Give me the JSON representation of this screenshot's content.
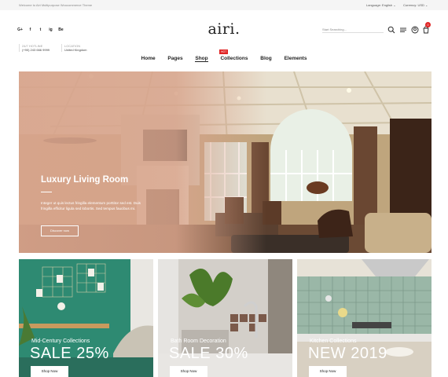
{
  "topbar": {
    "welcome": "Welcome to Airi Multipurpose Woocommerce Theme",
    "language": "Language: English",
    "currency": "Currency: USD"
  },
  "header": {
    "logo": "airi.",
    "social": [
      "G+",
      "f",
      "t",
      "ig",
      "Be"
    ],
    "search_placeholder": "Start Searching...",
    "cart_count": "0",
    "hotline_label": "24/7 HOTLINE",
    "hotline_value": "(+90) 243 666 9999",
    "location_label": "LOCATION",
    "location_value": "United Kingdom"
  },
  "nav": {
    "items": [
      "Home",
      "Pages",
      "Shop",
      "Collections",
      "Blog",
      "Elements"
    ],
    "active": "Shop",
    "hot_badge": "HOT"
  },
  "hero": {
    "title": "Luxury Living Room",
    "description": "Integer ut quis lectus fringilla elementum porttitor sed est. Duis fringilla efficitur ligula sed lobortis. Sed tempus faucibus mi.",
    "button": "Discover now"
  },
  "tiles": [
    {
      "category": "Mid-Century Collections",
      "sale": "SALE 25%",
      "button": "Shop Now"
    },
    {
      "category": "Bath Room Decoration",
      "sale": "SALE 30%",
      "button": "Shop Now"
    },
    {
      "category": "Kitchen Collections",
      "sale": "NEW 2019",
      "button": "Shop Now"
    }
  ],
  "icons": {
    "search": "search-icon",
    "menu": "menu-icon",
    "account": "account-icon",
    "cart": "cart-icon"
  },
  "colors": {
    "accent": "#e02424",
    "hero_overlay": "#d8a48c"
  }
}
